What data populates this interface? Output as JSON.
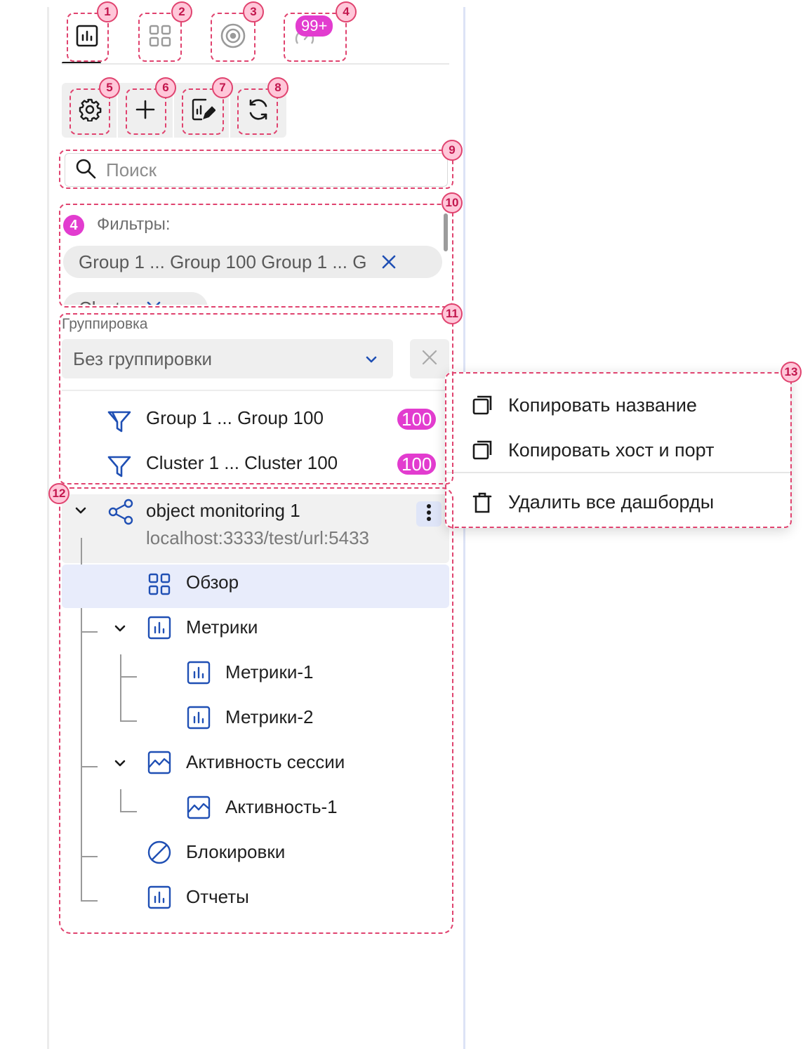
{
  "tabs": [
    {
      "name": "metrics-chart-icon",
      "badge": ""
    },
    {
      "name": "grid-icon",
      "badge": ""
    },
    {
      "name": "target-icon",
      "badge": ""
    },
    {
      "name": "gauge-icon",
      "badge": "99+"
    }
  ],
  "toolbar": {
    "icons": [
      "gear-icon",
      "plus-icon",
      "edit-chart-icon",
      "refresh-icon"
    ]
  },
  "search": {
    "placeholder": "Поиск"
  },
  "filters": {
    "count": "4",
    "title": "Фильтры:",
    "chips": [
      {
        "label": "Group 1 ... Group 100 Group 1 ... G"
      },
      {
        "label": "Clust"
      }
    ]
  },
  "grouping": {
    "label": "Группировка",
    "selected": "Без группировки",
    "rows": [
      {
        "label": "Group 1 ... Group 100",
        "count": "100"
      },
      {
        "label": "Cluster 1 ... Cluster 100",
        "count": "100"
      }
    ]
  },
  "tree": {
    "root": {
      "title": "object monitoring 1",
      "subtitle": "localhost:3333/test/url:5433"
    },
    "items": [
      {
        "label": "Обзор",
        "icon": "overview-grid-icon"
      },
      {
        "label": "Метрики",
        "icon": "chart-icon"
      },
      {
        "label": "Метрики-1",
        "icon": "chart-icon"
      },
      {
        "label": "Метрики-2",
        "icon": "chart-icon"
      },
      {
        "label": "Активность сессии",
        "icon": "activity-icon"
      },
      {
        "label": "Активность-1",
        "icon": "activity-icon"
      },
      {
        "label": "Блокировки",
        "icon": "block-icon"
      },
      {
        "label": "Отчеты",
        "icon": "chart-icon"
      }
    ]
  },
  "menu": {
    "items": [
      {
        "label": "Копировать название",
        "icon": "copy-icon"
      },
      {
        "label": "Копировать хост и порт",
        "icon": "copy-icon"
      },
      {
        "label": "Удалить все дашборды",
        "icon": "trash-icon"
      }
    ]
  },
  "markers": [
    "1",
    "2",
    "3",
    "4",
    "5",
    "6",
    "7",
    "8",
    "9",
    "10",
    "11",
    "12",
    "13"
  ],
  "colors": {
    "accent": "#1f4fb4",
    "badge": "#e23ccf",
    "annotation": "#e0436f",
    "selected": "#e8ecfb"
  }
}
